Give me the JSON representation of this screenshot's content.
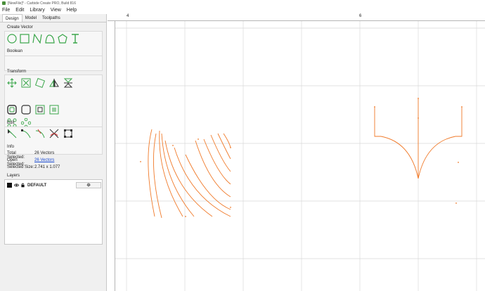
{
  "window": {
    "title": "[NewFile]* - Carbide Create PRO, Build 816"
  },
  "menu": [
    "File",
    "Edit",
    "Library",
    "View",
    "Help"
  ],
  "tabs": [
    "Design",
    "Model",
    "Toolpaths"
  ],
  "sections": {
    "create_vector": "Create Vector",
    "boolean": "Boolean",
    "transform": "Transform",
    "edit": "Edit",
    "info": "Info",
    "layers": "Layers"
  },
  "info": {
    "total_selected_label": "Total Selected:",
    "total_selected_value": "26 Vectors",
    "open_selected_label": "Open Selected:",
    "open_selected_value": "26 Vectors",
    "selected_size_label": "Selected Size:",
    "selected_size_value": "2.741 x 1.077"
  },
  "layers": [
    {
      "name": "DEFAULT",
      "color": "#111111"
    }
  ],
  "rulers": {
    "top_labels": [
      "4",
      "6"
    ]
  },
  "colors": {
    "tool_green": "#3aa64a",
    "vector_orange": "#f07a2a",
    "grid": "#d9d9d9",
    "link": "#1a4bd1"
  },
  "icons": {
    "create_vector": [
      "circle-icon",
      "rectangle-icon",
      "polyline-icon",
      "curve-icon",
      "polygon-icon",
      "text-icon"
    ],
    "transform": [
      "move-icon",
      "scale-icon",
      "rotate-icon",
      "mirror-icon",
      "flip-icon",
      "offset-icon",
      "rounded-square-icon",
      "align-icon",
      "trim-icon",
      "grid-array-icon",
      "circular-array-icon"
    ],
    "edit": [
      "node-edit-icon",
      "smooth-node-icon",
      "curve-node-icon",
      "cut-icon",
      "node-box-icon"
    ]
  }
}
